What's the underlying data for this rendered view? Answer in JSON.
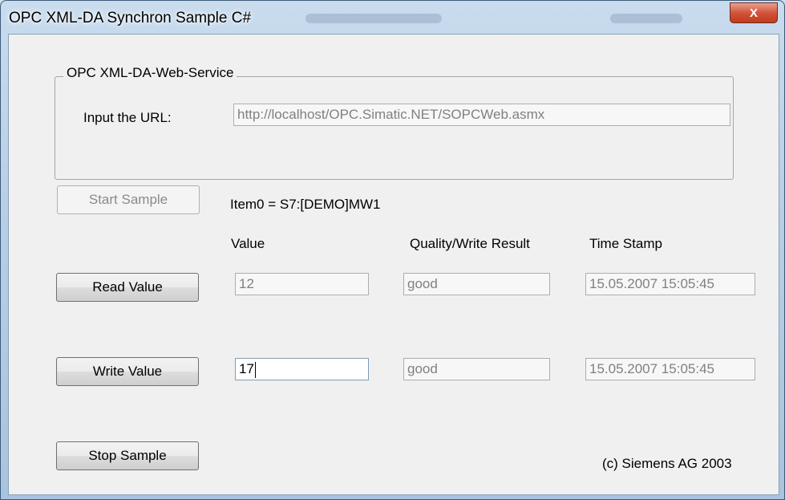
{
  "window": {
    "title": "OPC XML-DA Synchron Sample C#",
    "close_glyph": "X"
  },
  "service_group": {
    "legend": "OPC XML-DA-Web-Service",
    "url_label": "Input the URL:",
    "url_value": "http://localhost/OPC.Simatic.NET/SOPCWeb.asmx"
  },
  "item": {
    "label": "Item0 =  S7:[DEMO]MW1"
  },
  "columns": {
    "value": "Value",
    "quality": "Quality/Write Result",
    "timestamp": "Time Stamp"
  },
  "buttons": {
    "start": "Start Sample",
    "read": "Read Value",
    "write": "Write Value",
    "stop": "Stop Sample"
  },
  "read_row": {
    "value": "12",
    "quality": "good",
    "timestamp": "15.05.2007 15:05:45"
  },
  "write_row": {
    "value": "17",
    "quality": "good",
    "timestamp": "15.05.2007 15:05:45"
  },
  "copyright": "(c) Siemens AG 2003"
}
